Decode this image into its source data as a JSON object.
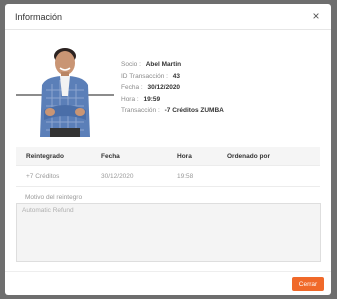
{
  "modal": {
    "title": "Información",
    "close_glyph": "×",
    "close_icon": "close-icon"
  },
  "member": {
    "socio_label": "Socio",
    "socio_value": "Abel Martin",
    "transaction_id_label": "ID Transacción",
    "transaction_id_value": "43",
    "date_label": "Fecha",
    "date_value": "30/12/2020",
    "time_label": "Hora",
    "time_value": "19:59",
    "transaction_label": "Transacción",
    "transaction_value": "-7 Créditos ZUMBA",
    "separator": ":"
  },
  "table": {
    "headers": [
      "Reintegrado",
      "Fecha",
      "Hora",
      "Ordenado por"
    ],
    "rows": [
      [
        "+7 Créditos",
        "30/12/2020",
        "19:58",
        ""
      ]
    ]
  },
  "reason": {
    "label": "Motivo del reintegro",
    "value": "Automatic Refund"
  },
  "footer": {
    "close_button_label": "Cerrar"
  },
  "colors": {
    "accent": "#f0692a",
    "shirt": "#5b7fb8"
  }
}
